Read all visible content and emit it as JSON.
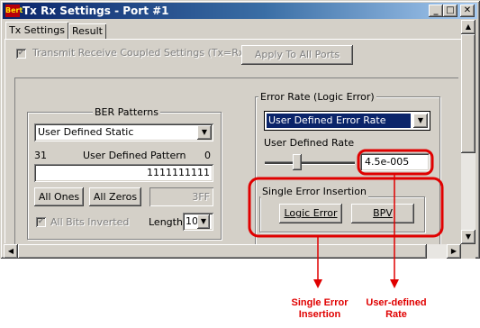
{
  "window": {
    "title": "Tx Rx Settings - Port #1",
    "icon_label": "Bert",
    "buttons": {
      "minimize": "_",
      "maximize": "□",
      "close": "✕"
    }
  },
  "tabs": [
    {
      "label": "Tx Settings",
      "active": true
    },
    {
      "label": "Result",
      "active": false
    }
  ],
  "coupled": {
    "label": "Transmit Receive Coupled Settings (Tx=Rx)",
    "checked": true,
    "apply_button": "Apply To All Ports"
  },
  "ber": {
    "group_label": "BER Patterns",
    "pattern_select": "User Defined Static",
    "range_high": "31",
    "pattern_label": "User Defined Pattern",
    "range_low": "0",
    "pattern_value": "1111111111",
    "all_ones": "All Ones",
    "all_zeros": "All Zeros",
    "hex_value": "3FF",
    "inverted_label": "All Bits Inverted",
    "inverted_checked": true,
    "length_label": "Length",
    "length_value": "10"
  },
  "error_rate": {
    "group_label": "Error Rate (Logic Error)",
    "select": "User Defined Error Rate",
    "rate_label": "User Defined Rate",
    "slider_level": 0.35,
    "rate_value": "4.5e-005"
  },
  "single_error": {
    "group_label": "Single Error Insertion",
    "logic_button": "Logic Error",
    "bpv_button": "BPV"
  },
  "annotations": {
    "left_line1": "Single Error",
    "left_line2": "Insertion",
    "right_line1": "User-defined",
    "right_line2": "Rate",
    "color": "#e00000"
  }
}
